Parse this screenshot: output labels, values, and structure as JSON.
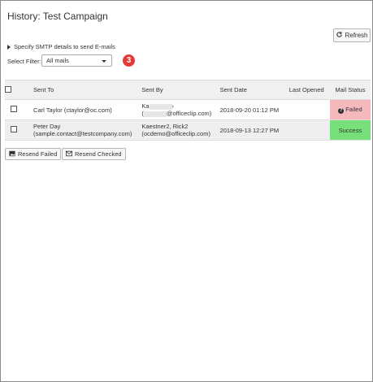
{
  "page": {
    "title": "History: Test Campaign"
  },
  "toolbar": {
    "refresh_label": "Refresh"
  },
  "smtp": {
    "label": "Specify SMTP details to send E-mails"
  },
  "filter": {
    "label": "Select Filter:",
    "selected": "All mails"
  },
  "step_badge": "3",
  "table": {
    "headers": {
      "sent_to": "Sent To",
      "sent_by": "Sent By",
      "sent_date": "Sent Date",
      "last_opened": "Last Opened",
      "mail_status": "Mail Status"
    },
    "rows": [
      {
        "sent_to_line1": "Carl Taylor (ctaylor@oc.com)",
        "sent_to_line2": "",
        "sent_by_line1": "Ka",
        "sent_by_line1_end": "›",
        "sent_by_line2_start": "(",
        "sent_by_line2": "@officeclip.com)",
        "sent_date": "2018-09-20 01:12 PM",
        "last_opened": "",
        "status": "Failed",
        "status_color": "#f5b8bd"
      },
      {
        "sent_to_line1": "Peter Day",
        "sent_to_line2": "(sample.contact@testcompany.com)",
        "sent_by_line1": "Kaestner2, Rick2",
        "sent_by_line2": "(ocdemo@officeclip.com)",
        "sent_date": "2018-09-13 12:27 PM",
        "last_opened": "",
        "status": "Success",
        "status_color": "#77e07a"
      }
    ]
  },
  "actions": {
    "resend_failed": "Resend Failed",
    "resend_checked": "Resend Checked"
  }
}
